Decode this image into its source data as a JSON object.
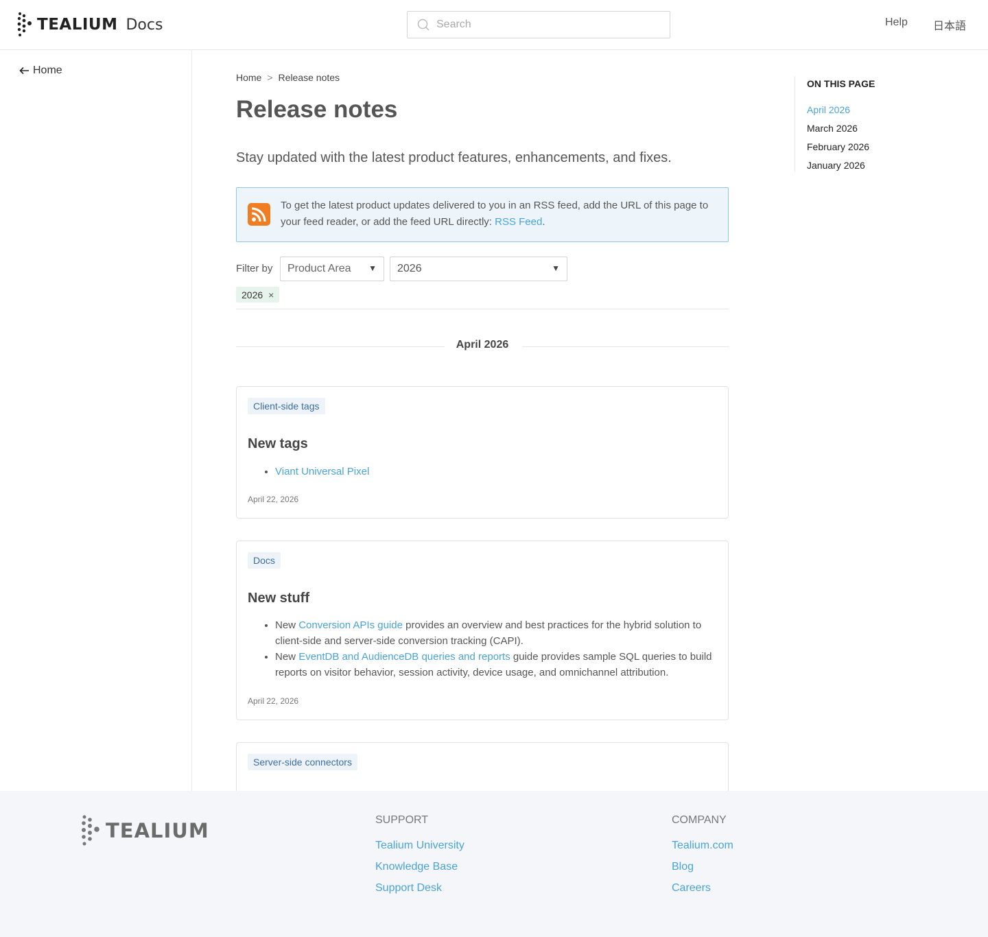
{
  "header": {
    "brand": "TEALIUM",
    "product": "Docs",
    "search_placeholder": "Search",
    "help": "Help",
    "language": "日本語"
  },
  "sidebar": {
    "home": "Home"
  },
  "breadcrumb": {
    "home": "Home",
    "separator": ">",
    "current": "Release notes"
  },
  "page": {
    "title": "Release notes",
    "lead": "Stay updated with the latest product features, enhancements, and fixes."
  },
  "callout": {
    "text": "To get the latest product updates delivered to you in an RSS feed, add the URL of this page to your feed reader, or add the feed URL directly: ",
    "link": "RSS Feed",
    "end": "."
  },
  "filter": {
    "label": "Filter by",
    "area_value": "Product Area",
    "year_value": "2026",
    "chip": "2026",
    "chip_remove": "×"
  },
  "month_heading": "April 2026",
  "cards": [
    {
      "tag": "Client-side tags",
      "title": "New tags",
      "items": [
        {
          "link": "Viant Universal Pixel"
        }
      ],
      "date": "April 22, 2026"
    },
    {
      "tag": "Docs",
      "title": "New stuff",
      "items": [
        {
          "pre": "New ",
          "link": "Conversion APIs guide",
          "post": " provides an overview and best practices for the hybrid solution to client-side and server-side conversion tracking (CAPI)."
        },
        {
          "pre": "New ",
          "link": "EventDB and AudienceDB queries and reports",
          "post": " guide provides sample SQL queries to build reports on visitor behavior, session activity, device usage, and omnichannel attribution."
        }
      ],
      "date": "April 22, 2026"
    },
    {
      "tag": "Server-side connectors"
    }
  ],
  "toc": {
    "title": "ON THIS PAGE",
    "items": [
      "April 2026",
      "March 2026",
      "February 2026",
      "January 2026"
    ]
  },
  "footer": {
    "brand": "TEALIUM",
    "support": {
      "title": "SUPPORT",
      "links": [
        "Tealium University",
        "Knowledge Base",
        "Support Desk"
      ]
    },
    "company": {
      "title": "COMPANY",
      "links": [
        "Tealium.com",
        "Blog",
        "Careers"
      ]
    }
  },
  "colors": {
    "link": "#4aa3d8",
    "rss": "#f07d22",
    "callout_bg": "#eef5fa",
    "callout_border": "#8ec6e6"
  },
  "icons": [
    "tealium-logo-icon",
    "search-icon",
    "back-arrow-icon",
    "rss-icon",
    "caret-down-icon",
    "close-icon"
  ]
}
